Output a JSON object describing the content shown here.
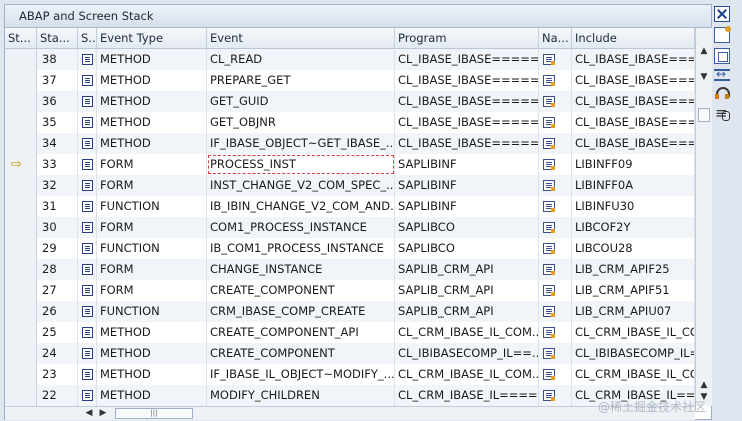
{
  "window": {
    "title": "ABAP and Screen Stack"
  },
  "columns": [
    "St...",
    "Sta...",
    "S...",
    "Event Type",
    "Event",
    "Program",
    "Na...",
    "Include"
  ],
  "rows": [
    {
      "sta": "38",
      "event_type": "METHOD",
      "event": "CL_READ",
      "program": "CL_IBASE_IBASE=====...",
      "include": "CL_IBASE_IBASE===..."
    },
    {
      "sta": "37",
      "event_type": "METHOD",
      "event": "PREPARE_GET",
      "program": "CL_IBASE_IBASE=====...",
      "include": "CL_IBASE_IBASE===..."
    },
    {
      "sta": "36",
      "event_type": "METHOD",
      "event": "GET_GUID",
      "program": "CL_IBASE_IBASE=====...",
      "include": "CL_IBASE_IBASE===..."
    },
    {
      "sta": "35",
      "event_type": "METHOD",
      "event": "GET_OBJNR",
      "program": "CL_IBASE_IBASE=====...",
      "include": "CL_IBASE_IBASE===..."
    },
    {
      "sta": "34",
      "event_type": "METHOD",
      "event": "IF_IBASE_OBJECT~GET_IBASE_...",
      "program": "CL_IBASE_IBASE=====...",
      "include": "CL_IBASE_IBASE===..."
    },
    {
      "sta": "33",
      "event_type": "FORM",
      "event": "PROCESS_INST",
      "program": "SAPLIBINF",
      "include": "LIBINFF09",
      "current": true
    },
    {
      "sta": "32",
      "event_type": "FORM",
      "event": "INST_CHANGE_V2_COM_SPEC_...",
      "program": "SAPLIBINF",
      "include": "LIBINFF0A"
    },
    {
      "sta": "31",
      "event_type": "FUNCTION",
      "event": "IB_IBIN_CHANGE_V2_COM_AND...",
      "program": "SAPLIBINF",
      "include": "LIBINFU30"
    },
    {
      "sta": "30",
      "event_type": "FORM",
      "event": "COM1_PROCESS_INSTANCE",
      "program": "SAPLIBCO",
      "include": "LIBCOF2Y"
    },
    {
      "sta": "29",
      "event_type": "FUNCTION",
      "event": "IB_COM1_PROCESS_INSTANCE",
      "program": "SAPLIBCO",
      "include": "LIBCOU28"
    },
    {
      "sta": "28",
      "event_type": "FORM",
      "event": "CHANGE_INSTANCE",
      "program": "SAPLIB_CRM_API",
      "include": "LIB_CRM_APIF25"
    },
    {
      "sta": "27",
      "event_type": "FORM",
      "event": "CREATE_COMPONENT",
      "program": "SAPLIB_CRM_API",
      "include": "LIB_CRM_APIF51"
    },
    {
      "sta": "26",
      "event_type": "FUNCTION",
      "event": "CRM_IBASE_COMP_CREATE",
      "program": "SAPLIB_CRM_API",
      "include": "LIB_CRM_APIU07"
    },
    {
      "sta": "25",
      "event_type": "METHOD",
      "event": "CREATE_COMPONENT_API",
      "program": "CL_CRM_IBASE_IL_COM...",
      "include": "CL_CRM_IBASE_IL_CO"
    },
    {
      "sta": "24",
      "event_type": "METHOD",
      "event": "CREATE_COMPONENT",
      "program": "CL_IBIBASECOMP_IL==...",
      "include": "CL_IBIBASECOMP_IL="
    },
    {
      "sta": "23",
      "event_type": "METHOD",
      "event": "IF_IBASE_IL_OBJECT~MODIFY_...",
      "program": "CL_CRM_IBASE_IL_COM...",
      "include": "CL_CRM_IBASE_IL_CO"
    },
    {
      "sta": "22",
      "event_type": "METHOD",
      "event": "MODIFY_CHILDREN",
      "program": "CL_CRM_IBASE_IL====...",
      "include": "CL_CRM_IBASE_IL===..."
    }
  ],
  "watermark": "@稀土掘金技术社区"
}
